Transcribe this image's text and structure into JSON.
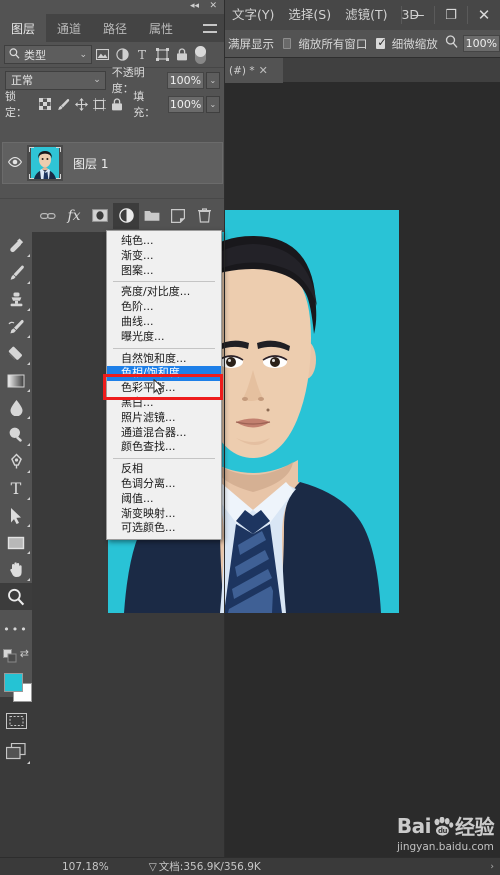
{
  "window": {
    "minimize": "—",
    "maximize": "❐",
    "close": "✕"
  },
  "menubar": {
    "items": [
      {
        "label": "文字(Y)",
        "name": "menu-type"
      },
      {
        "label": "选择(S)",
        "name": "menu-select"
      },
      {
        "label": "滤镜(T)",
        "name": "menu-filter"
      },
      {
        "label": "3D",
        "name": "menu-3d"
      }
    ]
  },
  "options_bar": {
    "fullscreen_label": "满屏显示",
    "zoom_all_windows_label": "缩放所有窗口",
    "zoom_all_windows_checked": false,
    "scrubby_zoom_label": "细微缩放",
    "scrubby_zoom_checked": true,
    "zoom_value": "100%"
  },
  "document_tab": {
    "title": "(#) *",
    "close": "✕"
  },
  "layers_panel": {
    "tabs": [
      {
        "label": "图层",
        "selected": true
      },
      {
        "label": "通道",
        "selected": false
      },
      {
        "label": "路径",
        "selected": false
      },
      {
        "label": "属性",
        "selected": false
      }
    ],
    "filter": {
      "label": "类型",
      "chevron": "⌄",
      "icons": [
        "image-filter-icon",
        "adjustment-filter-icon",
        "text-filter-icon",
        "shape-filter-icon",
        "smartobject-filter-icon"
      ]
    },
    "blend": {
      "mode": "正常",
      "chevron": "⌄",
      "opacity_label": "不透明度：",
      "opacity_value": "100%"
    },
    "lock": {
      "label": "锁定：",
      "fill_label": "填充：",
      "fill_value": "100%"
    },
    "layers": [
      {
        "name": "图层 1",
        "visible": true,
        "selected": true,
        "eye": "◉"
      }
    ],
    "bottom_buttons": [
      {
        "name": "link-layers-button",
        "glyph": "⚭"
      },
      {
        "name": "layer-style-fx-button",
        "glyph": "fx"
      },
      {
        "name": "layer-mask-button",
        "glyph": "▣"
      },
      {
        "name": "adjustment-layer-button",
        "glyph": "◑"
      },
      {
        "name": "new-group-button",
        "glyph": "▱"
      },
      {
        "name": "new-layer-button",
        "glyph": "❐"
      },
      {
        "name": "delete-layer-button",
        "glyph": "Ὕ1"
      }
    ]
  },
  "adjustment_menu": {
    "groups": [
      {
        "items": [
          {
            "label": "纯色...",
            "name": "menu-solid-color"
          },
          {
            "label": "渐变...",
            "name": "menu-gradient"
          },
          {
            "label": "图案...",
            "name": "menu-pattern"
          }
        ]
      },
      {
        "items": [
          {
            "label": "亮度/对比度...",
            "name": "menu-brightness-contrast"
          },
          {
            "label": "色阶...",
            "name": "menu-levels"
          },
          {
            "label": "曲线...",
            "name": "menu-curves"
          },
          {
            "label": "曝光度...",
            "name": "menu-exposure"
          }
        ]
      },
      {
        "items": [
          {
            "label": "自然饱和度...",
            "name": "menu-vibrance"
          },
          {
            "label": "色相/饱和度...",
            "name": "menu-hue-saturation",
            "highlighted": true
          },
          {
            "label": "色彩平衡...",
            "name": "menu-color-balance"
          },
          {
            "label": "黑白...",
            "name": "menu-black-white"
          },
          {
            "label": "照片滤镜...",
            "name": "menu-photo-filter"
          },
          {
            "label": "通道混合器...",
            "name": "menu-channel-mixer"
          },
          {
            "label": "颜色查找...",
            "name": "menu-color-lookup"
          }
        ]
      },
      {
        "items": [
          {
            "label": "反相",
            "name": "menu-invert"
          },
          {
            "label": "色调分离...",
            "name": "menu-posterize"
          },
          {
            "label": "阈值...",
            "name": "menu-threshold"
          },
          {
            "label": "渐变映射...",
            "name": "menu-gradient-map"
          },
          {
            "label": "可选颜色...",
            "name": "menu-selective-color"
          }
        ]
      }
    ]
  },
  "toolbar": {
    "tools": [
      {
        "name": "healing-brush-tool",
        "glyph": "healing"
      },
      {
        "name": "brush-tool",
        "glyph": "brush"
      },
      {
        "name": "clone-stamp-tool",
        "glyph": "stamp"
      },
      {
        "name": "history-brush-tool",
        "glyph": "history"
      },
      {
        "name": "eraser-tool",
        "glyph": "eraser"
      },
      {
        "name": "gradient-tool",
        "glyph": "gradient"
      },
      {
        "name": "blur-tool",
        "glyph": "drop"
      },
      {
        "name": "dodge-tool",
        "glyph": "dodge"
      },
      {
        "name": "pen-tool",
        "glyph": "pen"
      },
      {
        "name": "type-tool",
        "glyph": "T"
      },
      {
        "name": "path-selection-tool",
        "glyph": "arrow"
      },
      {
        "name": "rectangle-tool",
        "glyph": "rect"
      },
      {
        "name": "hand-tool",
        "glyph": "hand"
      },
      {
        "name": "zoom-tool",
        "glyph": "zoom",
        "active": true
      },
      {
        "name": "more-tools-button",
        "glyph": "•••"
      },
      {
        "name": "default-colors-button",
        "glyph": "default"
      }
    ],
    "foreground_color": "#25c3d4",
    "background_color": "#ffffff",
    "swap_glyph": "⇄",
    "quick_mask_name": "quick-mask-button",
    "screen_mode_name": "screen-mode-button"
  },
  "status_bar": {
    "zoom": "107.18%",
    "doc_icon": "▽",
    "doc_label": "文档:356.9K/356.9K",
    "arrow": "›"
  },
  "watermark": {
    "brand": "Bai",
    "brand2": "du",
    "suffix": "经验",
    "url": "jingyan.baidu.com"
  },
  "colors": {
    "panel_bg": "#535353",
    "canvas_bg": "#2b2b2b",
    "photo_bg": "#29c3d6",
    "highlight": "#1d7fe8",
    "annotation_red": "#ee1c1c"
  }
}
